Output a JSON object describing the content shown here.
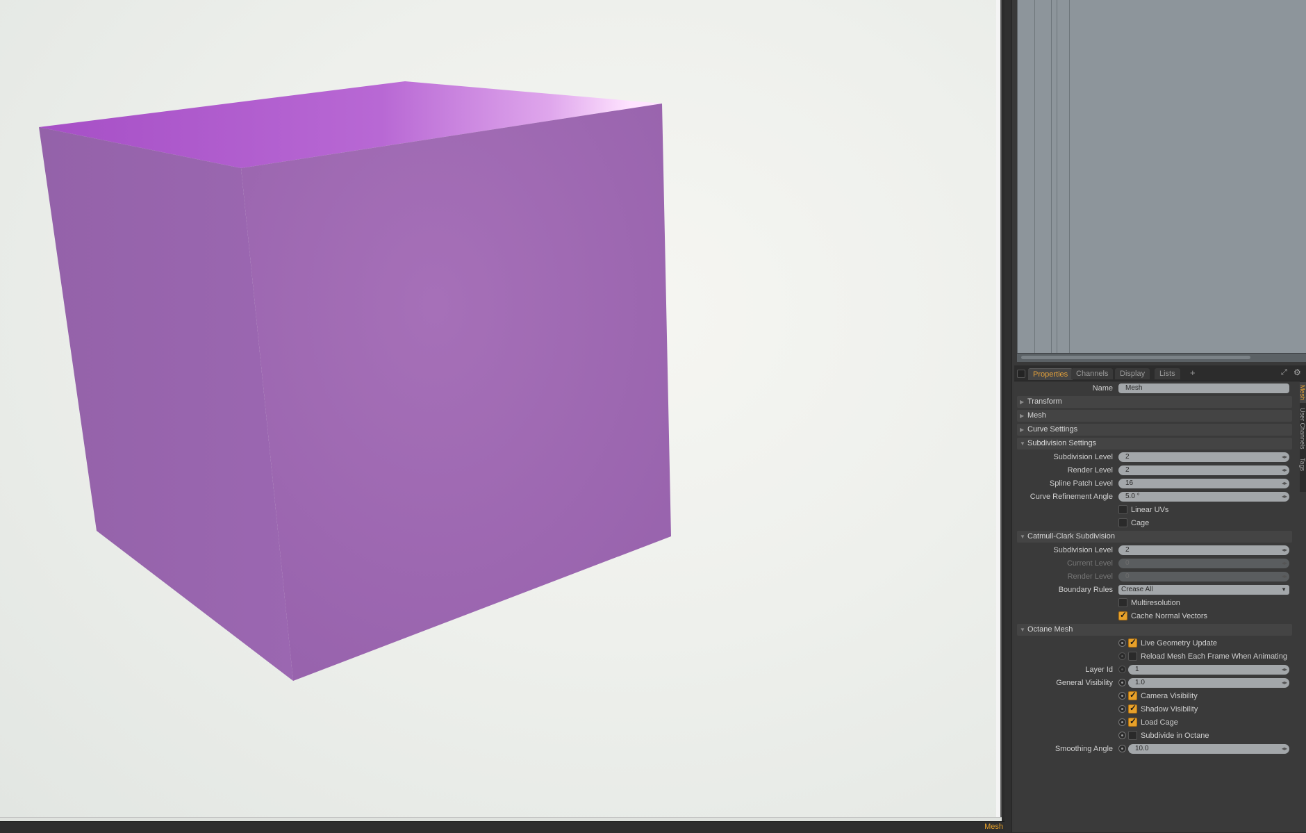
{
  "status": {
    "text": "Mesh"
  },
  "tabs": [
    {
      "label": "Properties",
      "active": true
    },
    {
      "label": "Channels",
      "active": false
    },
    {
      "label": "Display",
      "active": false
    },
    {
      "label": "Lists",
      "active": false
    }
  ],
  "tab_plus": "+",
  "side_tabs": [
    "Mesh",
    "User Channels",
    "Tags"
  ],
  "name_row": {
    "label": "Name",
    "value": "Mesh"
  },
  "sections": {
    "transform": "Transform",
    "mesh": "Mesh",
    "curve": "Curve Settings",
    "subdivision": "Subdivision Settings",
    "catmull": "Catmull-Clark Subdivision",
    "octane": "Octane Mesh"
  },
  "subdivision": {
    "subdivision_level": {
      "label": "Subdivision Level",
      "value": "2"
    },
    "render_level": {
      "label": "Render Level",
      "value": "2"
    },
    "spline_patch": {
      "label": "Spline Patch Level",
      "value": "16"
    },
    "curve_angle": {
      "label": "Curve Refinement Angle",
      "value": "5.0 °"
    },
    "linear_uvs": {
      "label": "Linear UVs",
      "checked": false
    },
    "cage": {
      "label": "Cage",
      "checked": false
    }
  },
  "catmull": {
    "subdivision_level": {
      "label": "Subdivision Level",
      "value": "2"
    },
    "current_level": {
      "label": "Current Level",
      "value": "0"
    },
    "render_level": {
      "label": "Render Level",
      "value": "0"
    },
    "boundary_rules": {
      "label": "Boundary Rules",
      "value": "Crease All"
    },
    "multiresolution": {
      "label": "Multiresolution",
      "checked": false
    },
    "cache_normals": {
      "label": "Cache Normal Vectors",
      "checked": true
    }
  },
  "octane": {
    "live_geometry": {
      "label": "Live Geometry Update",
      "checked": true
    },
    "reload_mesh": {
      "label": "Reload Mesh Each Frame When Animating",
      "checked": false
    },
    "layer_id": {
      "label": "Layer Id",
      "value": "1"
    },
    "general_visibility": {
      "label": "General Visibility",
      "value": "1.0"
    },
    "camera_visibility": {
      "label": "Camera Visibility",
      "checked": true
    },
    "shadow_visibility": {
      "label": "Shadow Visibility",
      "checked": true
    },
    "load_cage": {
      "label": "Load Cage",
      "checked": true
    },
    "subdivide_octane": {
      "label": "Subdivide in Octane",
      "checked": false
    },
    "smoothing_angle": {
      "label": "Smoothing Angle",
      "value": "10.0"
    }
  },
  "colors": {
    "accent": "#e7a12a",
    "cube": "#9c66b2",
    "cube_top": "#b563d0",
    "viewport_bg": "#eef0ec"
  }
}
